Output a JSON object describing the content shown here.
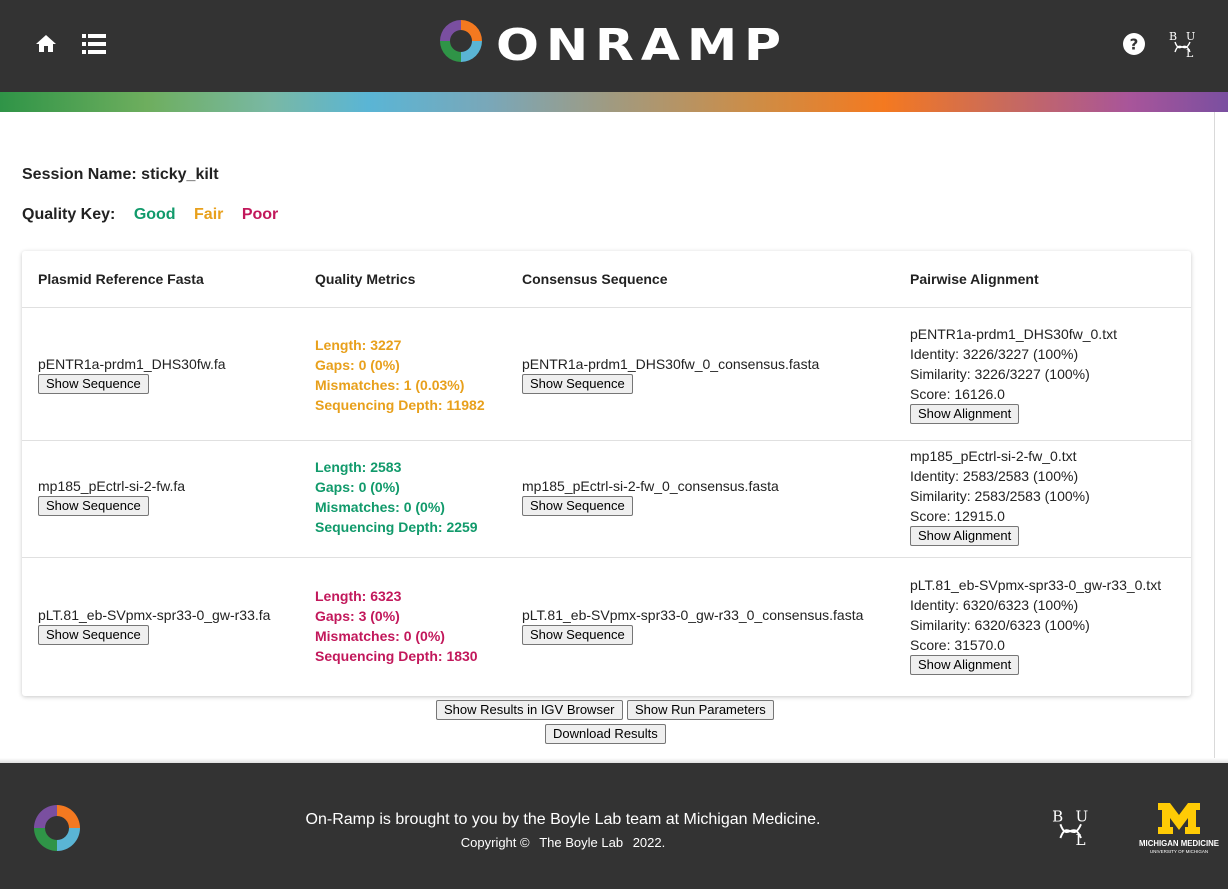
{
  "header": {
    "logo_text": "ONRAMP",
    "home_icon": "home-icon",
    "list_icon": "list-icon",
    "help_icon": "help-icon",
    "lab_logo": "boyle-lab-logo"
  },
  "session": {
    "label": "Session Name:",
    "name": "sticky_kilt"
  },
  "quality_key": {
    "label": "Quality Key:",
    "good": "Good",
    "fair": "Fair",
    "poor": "Poor",
    "colors": {
      "good": "#119a6b",
      "fair": "#e8a01c",
      "poor": "#c2185b"
    }
  },
  "table": {
    "headers": [
      "Plasmid Reference Fasta",
      "Quality Metrics",
      "Consensus Sequence",
      "Pairwise Alignment"
    ],
    "rows": [
      {
        "reference": "pENTR1a-prdm1_DHS30fw.fa",
        "show_sequence": "Show Sequence",
        "quality": "fair",
        "metrics": [
          "Length: 3227",
          "Gaps: 0 (0%)",
          "Mismatches: 1 (0.03%)",
          "Sequencing Depth: 11982"
        ],
        "consensus": "pENTR1a-prdm1_DHS30fw_0_consensus.fasta",
        "consensus_button": "Show Sequence",
        "alignment": [
          "pENTR1a-prdm1_DHS30fw_0.txt",
          "Identity: 3226/3227 (100%)",
          "Similarity: 3226/3227 (100%)",
          "Score: 16126.0"
        ],
        "alignment_button": "Show Alignment"
      },
      {
        "reference": "mp185_pEctrl-si-2-fw.fa",
        "show_sequence": "Show Sequence",
        "quality": "good",
        "metrics": [
          "Length: 2583",
          "Gaps: 0 (0%)",
          "Mismatches: 0 (0%)",
          "Sequencing Depth: 2259"
        ],
        "consensus": "mp185_pEctrl-si-2-fw_0_consensus.fasta",
        "consensus_button": "Show Sequence",
        "alignment": [
          "mp185_pEctrl-si-2-fw_0.txt",
          "Identity: 2583/2583 (100%)",
          "Similarity: 2583/2583 (100%)",
          "Score: 12915.0"
        ],
        "alignment_button": "Show Alignment"
      },
      {
        "reference": "pLT.81_eb-SVpmx-spr33-0_gw-r33.fa",
        "show_sequence": "Show Sequence",
        "quality": "poor",
        "metrics": [
          "Length: 6323",
          "Gaps: 3 (0%)",
          "Mismatches: 0 (0%)",
          "Sequencing Depth: 1830"
        ],
        "consensus": "pLT.81_eb-SVpmx-spr33-0_gw-r33_0_consensus.fasta",
        "consensus_button": "Show Sequence",
        "alignment": [
          "pLT.81_eb-SVpmx-spr33-0_gw-r33_0.txt",
          "Identity: 6320/6323 (100%)",
          "Similarity: 6320/6323 (100%)",
          "Score: 31570.0"
        ],
        "alignment_button": "Show Alignment"
      }
    ]
  },
  "actions": {
    "igv": "Show Results in IGV Browser",
    "params": "Show Run Parameters",
    "download": "Download Results"
  },
  "footer": {
    "tagline": "On-Ramp is brought to you by the Boyle Lab team at Michigan Medicine.",
    "copyright": "Copyright ©",
    "lab": "The Boyle Lab",
    "year": "2022.",
    "mich_logo_text": "MICHIGAN MEDICINE",
    "mich_logo_sub": "UNIVERSITY OF MICHIGAN"
  }
}
